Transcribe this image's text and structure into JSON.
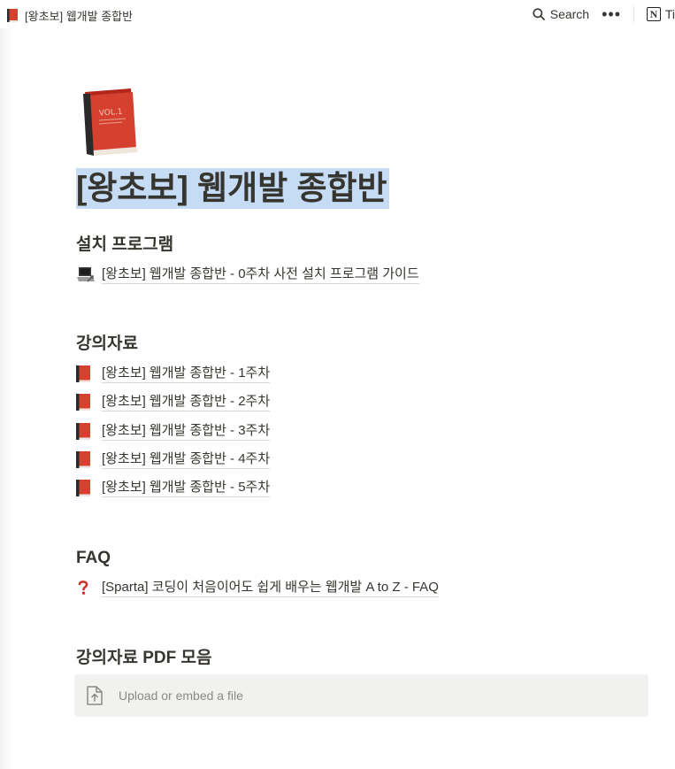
{
  "topbar": {
    "breadcrumb": "[왕초보] 웹개발 종합반",
    "search_label": "Search",
    "more_label": "•••",
    "logo_text": "Ti"
  },
  "page": {
    "title": "[왕초보] 웹개발 종합반",
    "icon": "book-icon"
  },
  "sections": {
    "install": {
      "heading": "설치 프로그램",
      "links": [
        {
          "icon": "laptop-icon",
          "label": "[왕초보] 웹개발 종합반 - 0주차 사전 설치 프로그램 가이드"
        }
      ]
    },
    "materials": {
      "heading": "강의자료",
      "links": [
        {
          "icon": "book-icon",
          "label": "[왕초보] 웹개발 종합반 - 1주차"
        },
        {
          "icon": "book-icon",
          "label": "[왕초보] 웹개발 종합반 - 2주차"
        },
        {
          "icon": "book-icon",
          "label": "[왕초보] 웹개발 종합반 - 3주차"
        },
        {
          "icon": "book-icon",
          "label": "[왕초보] 웹개발 종합반 - 4주차"
        },
        {
          "icon": "book-icon",
          "label": "[왕초보] 웹개발 종합반 - 5주차"
        }
      ]
    },
    "faq": {
      "heading": "FAQ",
      "links": [
        {
          "icon": "question-icon",
          "label": "[Sparta] 코딩이 처음이어도 쉽게 배우는 웹개발 A to Z - FAQ"
        }
      ]
    },
    "pdf": {
      "heading": "강의자료 PDF 모음",
      "upload_label": "Upload or embed a file"
    }
  },
  "colors": {
    "title_highlight": "#c6dcf4",
    "text": "#37352f",
    "book_red": "#d6402f",
    "upload_bg": "#f1f1ef"
  }
}
